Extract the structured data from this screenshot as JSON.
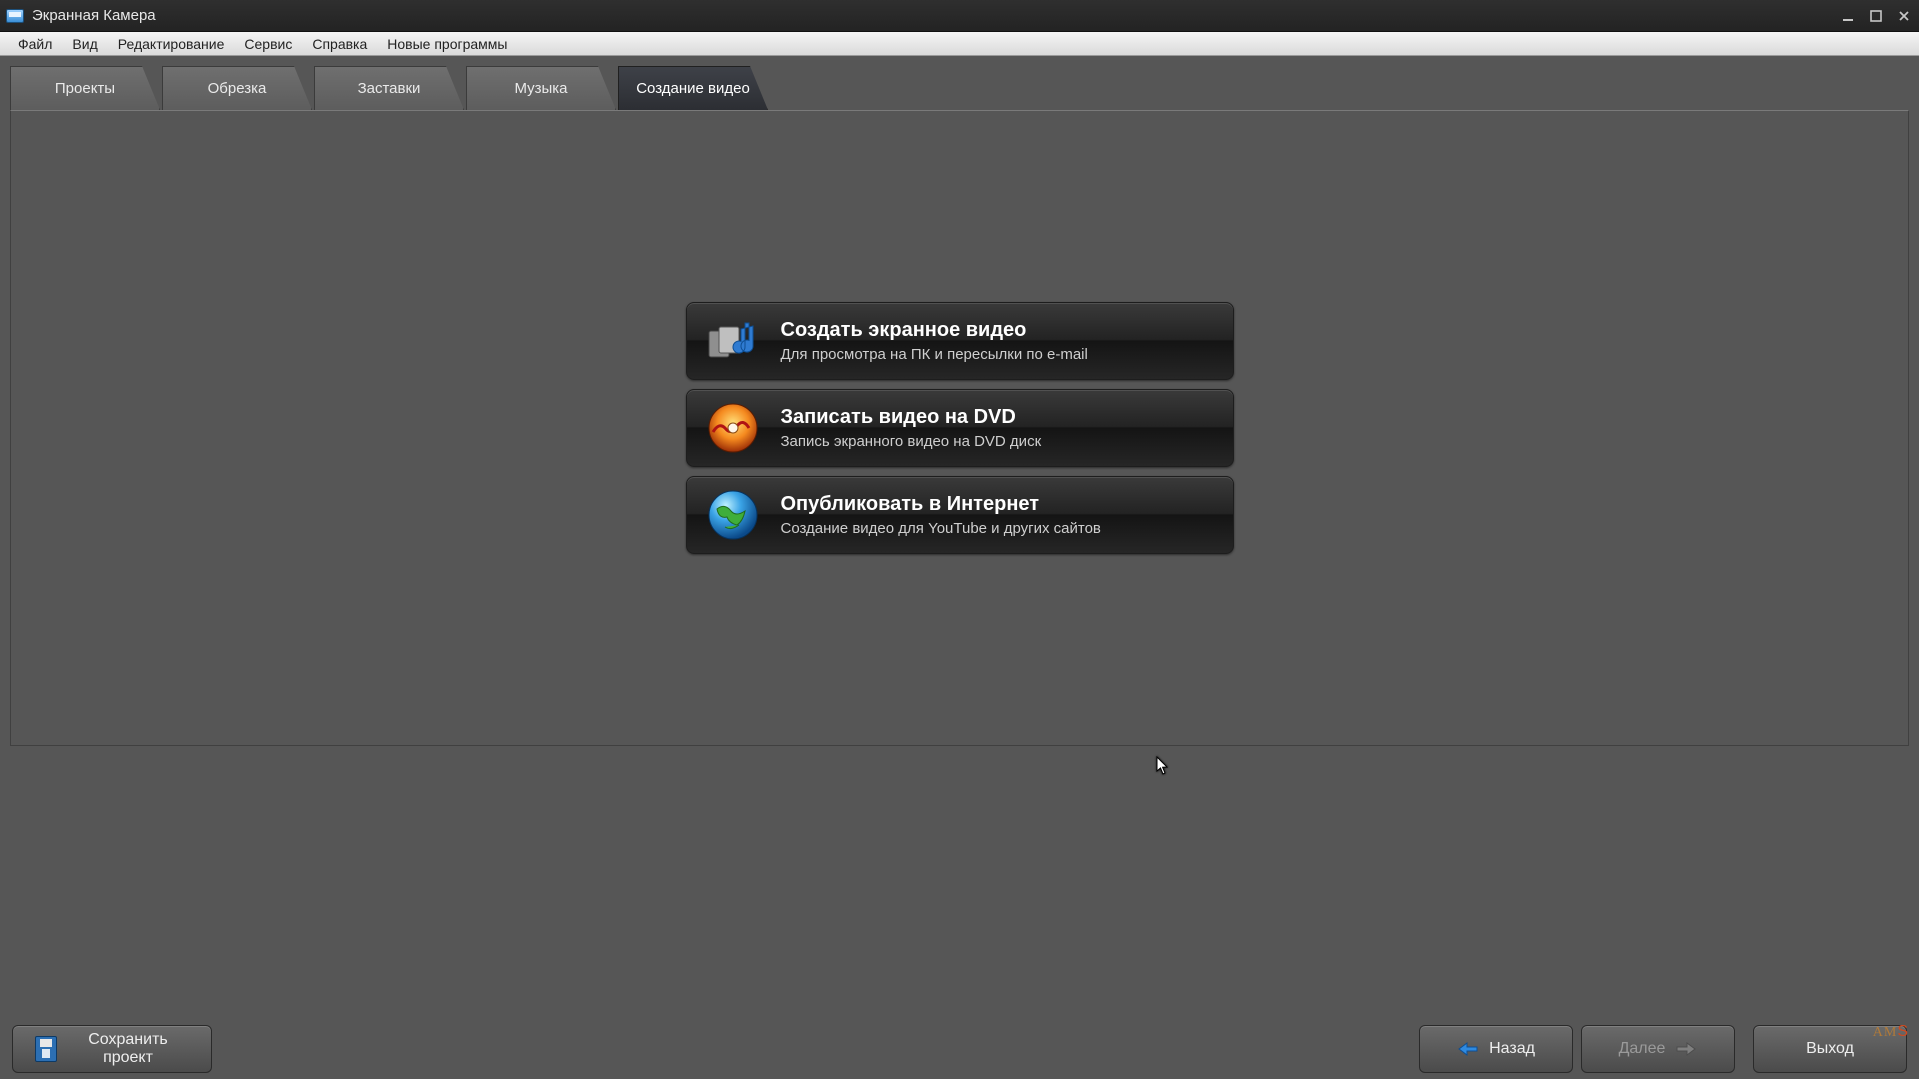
{
  "window": {
    "title": "Экранная Камера"
  },
  "menu": {
    "file": "Файл",
    "view": "Вид",
    "edit": "Редактирование",
    "service": "Сервис",
    "help": "Справка",
    "new_programs": "Новые программы"
  },
  "tabs": {
    "projects": "Проекты",
    "trim": "Обрезка",
    "intros": "Заставки",
    "music": "Музыка",
    "create_video": "Создание видео",
    "active": "create_video"
  },
  "options": {
    "screen_video": {
      "title": "Создать экранное видео",
      "subtitle": "Для просмотра на ПК и пересылки по e-mail"
    },
    "dvd": {
      "title": "Записать видео на DVD",
      "subtitle": "Запись экранного видео на DVD диск"
    },
    "publish": {
      "title": "Опубликовать в Интернет",
      "subtitle": "Создание видео для YouTube и других сайтов"
    }
  },
  "footer": {
    "save_project": "Сохранить проект",
    "back": "Назад",
    "next": "Далее",
    "exit": "Выход"
  },
  "brand": {
    "ams": "AMS"
  }
}
